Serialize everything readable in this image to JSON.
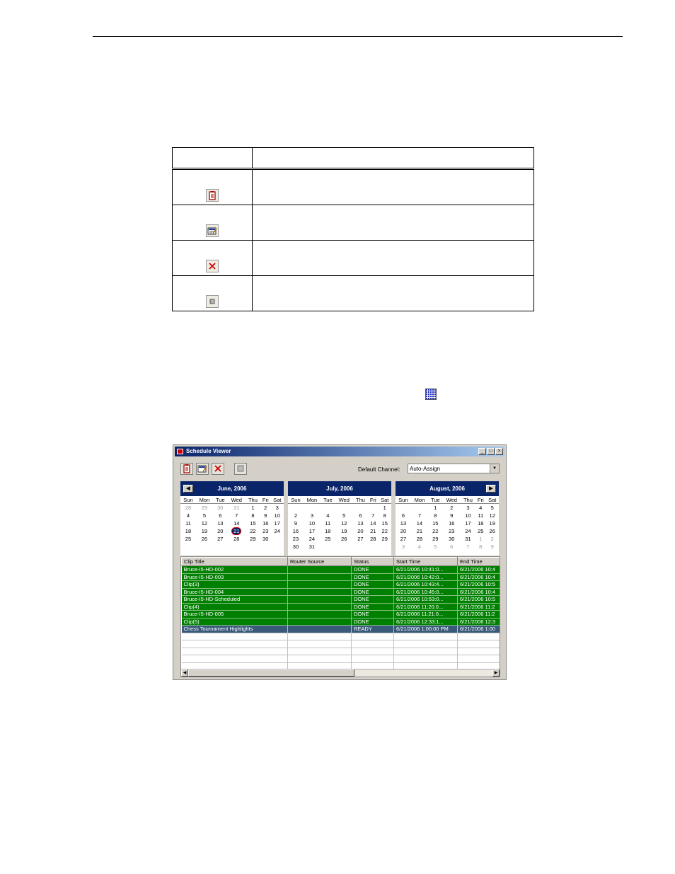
{
  "icon_table": {
    "icons": [
      "clipboard-icon",
      "edit-schedule-icon",
      "delete-x-icon",
      "stop-icon"
    ]
  },
  "window": {
    "title": "Schedule Viewer",
    "default_channel_label": "Default Channel:",
    "default_channel_value": "Auto-Assign"
  },
  "calendars": [
    {
      "month": "June, 2006",
      "weekdays": [
        "Sun",
        "Mon",
        "Tue",
        "Wed",
        "Thu",
        "Fri",
        "Sat"
      ],
      "weeks": [
        [
          "28",
          "29",
          "30",
          "31",
          "1",
          "2",
          "3"
        ],
        [
          "4",
          "5",
          "6",
          "7",
          "8",
          "9",
          "10"
        ],
        [
          "11",
          "12",
          "13",
          "14",
          "15",
          "16",
          "17"
        ],
        [
          "18",
          "19",
          "20",
          "21",
          "22",
          "23",
          "24"
        ],
        [
          "25",
          "26",
          "27",
          "28",
          "29",
          "30",
          ""
        ]
      ]
    },
    {
      "month": "July, 2006",
      "weekdays": [
        "Sun",
        "Mon",
        "Tue",
        "Wed",
        "Thu",
        "Fri",
        "Sat"
      ],
      "weeks": [
        [
          "",
          "",
          "",
          "",
          "",
          "",
          "1"
        ],
        [
          "2",
          "3",
          "4",
          "5",
          "6",
          "7",
          "8"
        ],
        [
          "9",
          "10",
          "11",
          "12",
          "13",
          "14",
          "15"
        ],
        [
          "16",
          "17",
          "18",
          "19",
          "20",
          "21",
          "22"
        ],
        [
          "23",
          "24",
          "25",
          "26",
          "27",
          "28",
          "29"
        ],
        [
          "30",
          "31",
          "",
          "",
          "",
          "",
          ""
        ]
      ]
    },
    {
      "month": "August, 2006",
      "weekdays": [
        "Sun",
        "Mon",
        "Tue",
        "Wed",
        "Thu",
        "Fri",
        "Sat"
      ],
      "weeks": [
        [
          "",
          "",
          "1",
          "2",
          "3",
          "4",
          "5"
        ],
        [
          "6",
          "7",
          "8",
          "9",
          "10",
          "11",
          "12"
        ],
        [
          "13",
          "14",
          "15",
          "16",
          "17",
          "18",
          "19"
        ],
        [
          "20",
          "21",
          "22",
          "23",
          "24",
          "25",
          "26"
        ],
        [
          "27",
          "28",
          "29",
          "30",
          "31",
          "1",
          "2"
        ],
        [
          "3",
          "4",
          "5",
          "6",
          "7",
          "8",
          "9"
        ]
      ]
    }
  ],
  "grid": {
    "columns": [
      "Clip Title",
      "Router Source",
      "Status",
      "Start Time",
      "End Time"
    ],
    "rows": [
      {
        "title": "Bruce-I5-HD-002",
        "source": "",
        "status": "DONE",
        "start": "6/21/2006 10:41:0...",
        "end": "6/21/2006 10:4",
        "state": "done"
      },
      {
        "title": "Bruce-I5-HD-003",
        "source": "",
        "status": "DONE",
        "start": "6/21/2006 10:42:0...",
        "end": "6/21/2006 10:4",
        "state": "done"
      },
      {
        "title": "Clip(3)",
        "source": "",
        "status": "DONE",
        "start": "6/21/2006 10:43:4...",
        "end": "6/21/2006 10:5",
        "state": "done"
      },
      {
        "title": "Bruce-I5-HD-004",
        "source": "",
        "status": "DONE",
        "start": "6/21/2006 10:45:0...",
        "end": "6/21/2006 10:4",
        "state": "done"
      },
      {
        "title": "Bruce-I5-HD-Scheduled",
        "source": "",
        "status": "DONE",
        "start": "6/21/2006 10:53:0...",
        "end": "6/21/2006 10:5",
        "state": "done"
      },
      {
        "title": "Clip(4)",
        "source": "",
        "status": "DONE",
        "start": "6/21/2006 11:20:0...",
        "end": "6/21/2006 11:2",
        "state": "done"
      },
      {
        "title": "Bruce-I5-HD-005",
        "source": "",
        "status": "DONE",
        "start": "6/21/2006 11:21:0...",
        "end": "6/21/2006 11:2",
        "state": "done"
      },
      {
        "title": "Clip(5)",
        "source": "",
        "status": "DONE",
        "start": "6/21/2006 12:33:1...",
        "end": "6/21/2006 12:3",
        "state": "done"
      },
      {
        "title": "Chess Tournament Highlights",
        "source": "",
        "status": "READY",
        "start": "6/21/2006 1:00:00 PM",
        "end": "6/21/2006 1:00",
        "state": "ready"
      },
      {
        "title": "",
        "source": "",
        "status": "",
        "start": "",
        "end": "",
        "state": "empty"
      },
      {
        "title": "",
        "source": "",
        "status": "",
        "start": "",
        "end": "",
        "state": "empty"
      },
      {
        "title": "",
        "source": "",
        "status": "",
        "start": "",
        "end": "",
        "state": "empty"
      },
      {
        "title": "",
        "source": "",
        "status": "",
        "start": "",
        "end": "",
        "state": "empty"
      },
      {
        "title": "",
        "source": "",
        "status": "",
        "start": "",
        "end": "",
        "state": "empty"
      },
      {
        "title": "",
        "source": "",
        "status": "",
        "start": "",
        "end": "",
        "state": "empty"
      }
    ]
  },
  "colors": {
    "titlebar": "#0a246a",
    "done_row": "#008000",
    "ready_row": "#3a5a7a"
  }
}
